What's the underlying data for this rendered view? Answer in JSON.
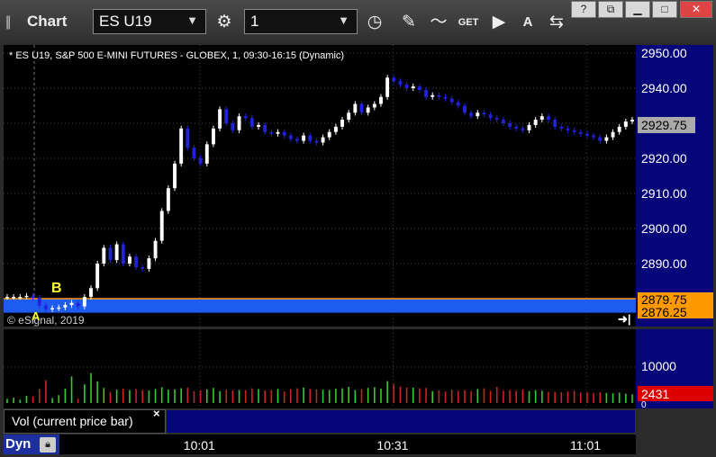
{
  "titlebar": {
    "grip": "||",
    "title": "Chart",
    "symbol": "ES U19",
    "interval": "1",
    "icons": [
      "gear-icon",
      "clock-icon",
      "pencil-icon",
      "study-icon",
      "get-icon",
      "play-icon",
      "alert-icon",
      "link-icon"
    ],
    "get_label": "GET",
    "alert_label": "A"
  },
  "chart_info": "* ES U19, S&P 500 E-MINI FUTURES - GLOBEX, 1, 09:30-16:15 (Dynamic)",
  "watermark": "© eSignal, 2019",
  "markers": {
    "a": "A",
    "b": "B"
  },
  "price_tags": {
    "last": "2929.75",
    "high_line": "2879.75",
    "low_line": "2876.25"
  },
  "volume_tags": {
    "current": "2431",
    "scale": "10000",
    "zero": "0"
  },
  "legend": {
    "label": "Vol (current price bar)",
    "close": "×"
  },
  "footer": {
    "mode": "Dyn"
  },
  "colors": {
    "up": "#ffffff",
    "down": "#2222dd",
    "band": "#1e5cf0",
    "band_tag": "#ff9900",
    "vol_up": "#33cc33",
    "vol_down": "#cc2222",
    "axis_bg": "#06067a"
  },
  "chart_data": {
    "type": "candlestick",
    "price_axis": {
      "ticks": [
        2890,
        2900,
        2910,
        2920,
        2930,
        2940,
        2950
      ],
      "tick_labels": [
        "2890.00",
        "2900.00",
        "2910.00",
        "2920.00",
        "2930.00",
        "2940.00",
        "2950.00"
      ]
    },
    "volume_axis": {
      "ticks": [
        10000,
        0
      ],
      "tick_labels": [
        "10000",
        "0"
      ]
    },
    "time_axis": {
      "tick_labels": [
        "10:01",
        "10:31",
        "11:01"
      ]
    },
    "grid": true,
    "close": [
      2880.5,
      2880.5,
      2880.5,
      2880.8,
      2880.3,
      2878.0,
      2877.0,
      2877.3,
      2877.5,
      2878.2,
      2878.8,
      2877.8,
      2880.5,
      2883.0,
      2890.0,
      2894.5,
      2891.0,
      2895.5,
      2890.0,
      2892.0,
      2889.0,
      2888.5,
      2891.5,
      2896.5,
      2905.0,
      2911.5,
      2918.5,
      2928.5,
      2923.0,
      2920.0,
      2918.5,
      2924.0,
      2928.5,
      2934.0,
      2930.0,
      2928.0,
      2932.0,
      2931.5,
      2929.0,
      2929.5,
      2927.5,
      2927.0,
      2927.5,
      2926.5,
      2925.5,
      2925.0,
      2926.5,
      2925.0,
      2924.5,
      2926.0,
      2927.5,
      2929.0,
      2931.0,
      2933.0,
      2935.5,
      2933.0,
      2934.5,
      2935.5,
      2937.5,
      2943.0,
      2942.0,
      2941.0,
      2940.0,
      2940.5,
      2939.5,
      2937.5,
      2938.0,
      2937.5,
      2937.0,
      2936.0,
      2935.0,
      2933.0,
      2932.0,
      2933.0,
      2932.5,
      2931.5,
      2931.0,
      2930.0,
      2929.0,
      2928.5,
      2928.0,
      2929.5,
      2931.0,
      2932.0,
      2931.0,
      2929.0,
      2928.5,
      2928.0,
      2927.5,
      2927.0,
      2926.5,
      2926.0,
      2925.0,
      2926.0,
      2927.5,
      2929.0,
      2930.5,
      2931.0
    ],
    "band": {
      "high": 2879.75,
      "low": 2876.25
    },
    "volume": [
      1200,
      1500,
      900,
      2000,
      1800,
      3900,
      6300,
      1400,
      2200,
      4000,
      7400,
      1200,
      5200,
      8300,
      6000,
      4200,
      3100,
      3700,
      4000,
      3600,
      3900,
      3600,
      3500,
      3900,
      4400,
      3700,
      3800,
      4100,
      4300,
      3300,
      3500,
      3800,
      4200,
      3300,
      3700,
      3500,
      3600,
      3600,
      4100,
      3900,
      3500,
      3600,
      3900,
      3200,
      3800,
      4100,
      4300,
      3900,
      3800,
      3700,
      3600,
      4000,
      4100,
      4500,
      3600,
      3900,
      4200,
      4400,
      4000,
      6100,
      5300,
      4600,
      4300,
      4300,
      4100,
      4200,
      3300,
      3500,
      3200,
      3700,
      3400,
      3600,
      3300,
      3900,
      4100,
      3400,
      4500,
      3400,
      3600,
      3400,
      3700,
      3300,
      3600,
      3400,
      3100,
      3100,
      3000,
      3200,
      3400,
      2900,
      3000,
      2800,
      3000,
      2800,
      2700,
      2900,
      2600,
      2431
    ]
  }
}
